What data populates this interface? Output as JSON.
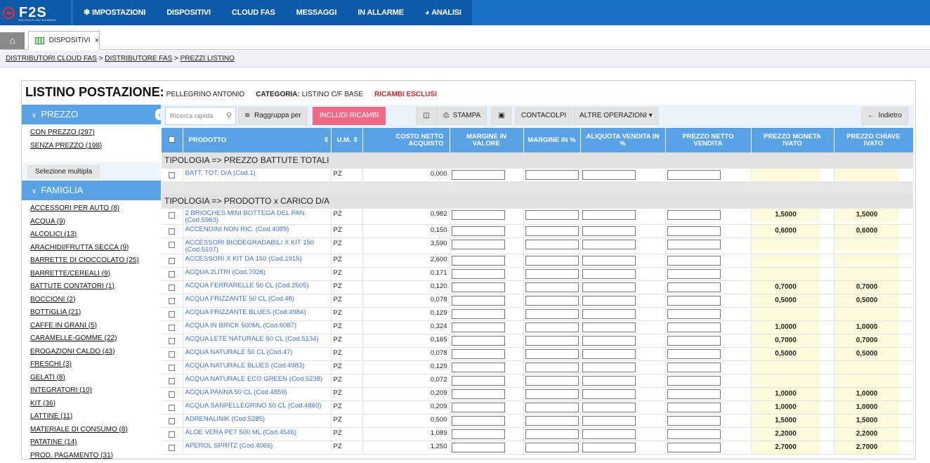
{
  "brand": {
    "logo_text": "F2S",
    "logo_sub": "ANY PLACE, ANY BUSINESS"
  },
  "nav": [
    {
      "label": "IMPOSTAZIONI",
      "icon": "gear-icon"
    },
    {
      "label": "DISPOSITIVI"
    },
    {
      "label": "CLOUD FAS"
    },
    {
      "label": "MESSAGGI"
    },
    {
      "label": "IN ALLARME"
    },
    {
      "label": "ANALISI",
      "icon": "pie-icon"
    }
  ],
  "tabs": {
    "home": "home",
    "active": "DISPOSITIVI",
    "close": "×"
  },
  "breadcrumb": [
    "DISTRIBUTORI CLOUD FAS",
    "DISTRIBUTORE FAS",
    "PREZZI LISTINO"
  ],
  "header": {
    "title": "LISTINO POSTAZIONE:",
    "name": "PELLEGRINO ANTONIO",
    "category_label": "CATEGORIA:",
    "category_value": "LISTINO C/F BASE",
    "flag": "RICAMBI ESCLUSI"
  },
  "sidebar": {
    "prezzo_title": "PREZZO",
    "prezzo_items": [
      "CON PREZZO (297)",
      "SENZA PREZZO (198)"
    ],
    "multi_select": "Selezione multipla",
    "famiglia_title": "FAMIGLIA",
    "famiglia_items": [
      "ACCESSORI PER AUTO (8)",
      "ACQUA (9)",
      "ALCOLICI (13)",
      "ARACHIDI/FRUTTA SECCA (9)",
      "BARRETTE DI CIOCCOLATO (25)",
      "BARRETTE/CEREALI (9)",
      "BATTUTE CONTATORI (1)",
      "BOCCIONI (2)",
      "BOTTIGLIA (21)",
      "CAFFE IN GRANI (5)",
      "CARAMELLE-GOMME (22)",
      "EROGAZIONI CALDO (43)",
      "FRESCHI (3)",
      "GELATI (8)",
      "INTEGRATORI (10)",
      "KIT (36)",
      "LATTINE (11)",
      "MATERIALE DI CONSUMO (8)",
      "PATATINE (14)",
      "PROD. PAGAMENTO (31)"
    ]
  },
  "toolbar": {
    "search_placeholder": "Ricerca rapida",
    "group_label": "Raggruppa per",
    "include_label": "INCLUDI RICAMBI",
    "print_label": "STAMPA",
    "counters_label": "CONTACOLPI",
    "more_label": "ALTRE OPERAZIONI",
    "back_label": "Indietro"
  },
  "columns": [
    "PRODOTTO",
    "U.M.",
    "COSTO NETTO ACQUISTO",
    "MARGINE IN VALORE",
    "MARGINE IN %",
    "ALIQUOTA VENDITA IN %",
    "PREZZO NETTO VENDITA",
    "PREZZO MONETA IVATO",
    "PREZZO CHIAVE IVATO"
  ],
  "groups": [
    {
      "title": "TIPOLOGIA => PREZZO BATTUTE TOTALI",
      "rows": [
        {
          "name": "BATT. TOT. D/A (Cod.1)",
          "um": "PZ",
          "cost": "0,000",
          "moneta": "",
          "chiave": ""
        }
      ]
    },
    {
      "title": "TIPOLOGIA => PRODOTTO x CARICO D/A",
      "rows": [
        {
          "name": "2 BRIOCHES MINI BOTTEGA DEL PAN. (Cod.5963)",
          "um": "PZ",
          "cost": "0,982",
          "moneta": "1,5000",
          "chiave": "1,5000"
        },
        {
          "name": "ACCENDINI NON RIC. (Cod.4089)",
          "um": "PZ",
          "cost": "0,150",
          "moneta": "0,6000",
          "chiave": "0,6000"
        },
        {
          "name": "ACCESSORI BIODEGRADABILI X KIT 150 (Cod.5107)",
          "um": "PZ",
          "cost": "3,590",
          "moneta": "",
          "chiave": ""
        },
        {
          "name": "ACCESSORI X KIT DA 150 (Cod.1915)",
          "um": "PZ",
          "cost": "2,600",
          "moneta": "",
          "chiave": ""
        },
        {
          "name": "ACQUA 2LITRI (Cod.7026)",
          "um": "PZ",
          "cost": "0,171",
          "moneta": "",
          "chiave": ""
        },
        {
          "name": "ACQUA FERRARELLE 50 CL (Cod.2505)",
          "um": "PZ",
          "cost": "0,120",
          "moneta": "0,7000",
          "chiave": "0,7000"
        },
        {
          "name": "ACQUA FRIZZANTE 50 CL (Cod.48)",
          "um": "PZ",
          "cost": "0,078",
          "moneta": "0,5000",
          "chiave": "0,5000"
        },
        {
          "name": "ACQUA FRIZZANTE BLUES (Cod.4984)",
          "um": "PZ",
          "cost": "0,129",
          "moneta": "",
          "chiave": ""
        },
        {
          "name": "ACQUA IN BRICK 500ML (Cod.6087)",
          "um": "PZ",
          "cost": "0,324",
          "moneta": "1,0000",
          "chiave": "1,0000"
        },
        {
          "name": "ACQUA LETE NATURALE 50 CL (Cod.5134)",
          "um": "PZ",
          "cost": "0,165",
          "moneta": "0,7000",
          "chiave": "0,7000"
        },
        {
          "name": "ACQUA NATURALE 50 CL (Cod.47)",
          "um": "PZ",
          "cost": "0,078",
          "moneta": "0,5000",
          "chiave": "0,5000"
        },
        {
          "name": "ACQUA NATURALE BLUES (Cod.4983)",
          "um": "PZ",
          "cost": "0,129",
          "moneta": "",
          "chiave": ""
        },
        {
          "name": "ACQUA NATURALE ECO GREEN (Cod.5238)",
          "um": "PZ",
          "cost": "0,072",
          "moneta": "",
          "chiave": ""
        },
        {
          "name": "ACQUA PANNA 50 CL (Cod.4859)",
          "um": "PZ",
          "cost": "0,209",
          "moneta": "1,0000",
          "chiave": "1,0000"
        },
        {
          "name": "ACQUA SANPELLEGRINO 50 CL (Cod.4860)",
          "um": "PZ",
          "cost": "0,209",
          "moneta": "1,0000",
          "chiave": "1,0000"
        },
        {
          "name": "ADRENALINIK (Cod.5285)",
          "um": "PZ",
          "cost": "0,500",
          "moneta": "1,5000",
          "chiave": "1,5000"
        },
        {
          "name": "ALOE VERA PET 500 ML (Cod.4546)",
          "um": "PZ",
          "cost": "1,089",
          "moneta": "2,2000",
          "chiave": "2,2000"
        },
        {
          "name": "APEROL SPRITZ (Cod.4066)",
          "um": "PZ",
          "cost": "1,250",
          "moneta": "2,7000",
          "chiave": "2,7000"
        }
      ]
    }
  ]
}
